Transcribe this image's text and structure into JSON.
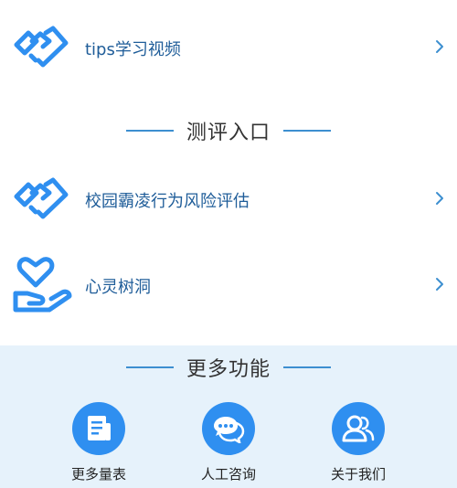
{
  "colors": {
    "accent": "#2f8ff0",
    "icon_stroke": "#2f8ff0",
    "label_text": "#1f5d99",
    "panel_bg": "#e6f2fb",
    "chevron": "#3d8fd0"
  },
  "tips": {
    "label": "tips学习视频",
    "icon": "handshake-icon"
  },
  "assessment_section": {
    "title": "测评入口",
    "items": [
      {
        "label": "校园霸凌行为风险评估",
        "icon": "handshake-icon"
      },
      {
        "label": "心灵树洞",
        "icon": "heart-in-hand-icon"
      }
    ]
  },
  "more_section": {
    "title": "更多功能",
    "features": [
      {
        "label": "更多量表",
        "icon": "document-icon"
      },
      {
        "label": "人工咨询",
        "icon": "chat-bubbles-icon"
      },
      {
        "label": "关于我们",
        "icon": "people-icon"
      }
    ]
  }
}
